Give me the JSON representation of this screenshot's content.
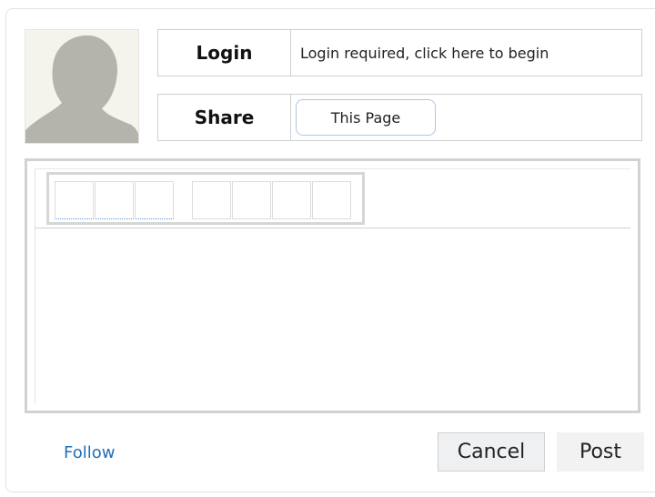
{
  "profile": {
    "login_label": "Login",
    "login_value": "Login required, click here to begin",
    "share_label": "Share",
    "share_button": "This Page"
  },
  "editor": {
    "toolbar_buttons": [
      "",
      "",
      "",
      "",
      "",
      "",
      ""
    ]
  },
  "footer": {
    "follow_link": "Follow",
    "cancel_label": "Cancel",
    "post_label": "Post"
  }
}
